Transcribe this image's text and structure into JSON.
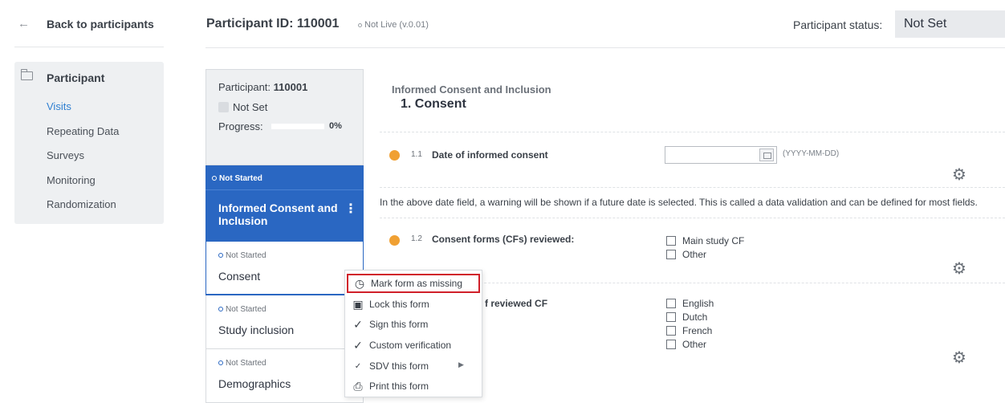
{
  "nav": {
    "back_label": "Back to participants",
    "back_icon": "arrow-left-icon",
    "section_title": "Participant",
    "section_icon": "folder-icon",
    "items": [
      {
        "label": "Visits",
        "active": true
      },
      {
        "label": "Repeating Data",
        "active": false
      },
      {
        "label": "Surveys",
        "active": false
      },
      {
        "label": "Monitoring",
        "active": false
      },
      {
        "label": "Randomization",
        "active": false
      }
    ]
  },
  "header": {
    "participant_id_title": "Participant ID: 110001",
    "live_status": "Not Live (v.0.01)",
    "status_label": "Participant status:",
    "status_value": "Not Set"
  },
  "summary": {
    "participant_label": "Participant: ",
    "participant_id": "110001",
    "status": "Not Set",
    "progress_label": "Progress:",
    "progress_percent": "0%",
    "progress_fraction": 0
  },
  "forms": [
    {
      "status": "Not Started",
      "name": "Informed Consent and Inclusion",
      "selected": true
    },
    {
      "status": "Not Started",
      "name": "Consent"
    },
    {
      "status": "Not Started",
      "name": "Study inclusion"
    },
    {
      "status": "Not Started",
      "name": "Demographics"
    }
  ],
  "main": {
    "section_title": "Informed Consent and Inclusion",
    "form_title": "1. Consent",
    "info_text": "In the above date field, a warning will be shown if a future date is selected. This is called a data validation and can be defined for most fields.",
    "questions": [
      {
        "number": "1.1",
        "label": "Date of informed consent",
        "date_hint": "(YYYY-MM-DD)"
      },
      {
        "number": "1.2",
        "label": "Consent forms (CFs) reviewed:",
        "options": [
          "Main study CF",
          "Other"
        ]
      },
      {
        "label_visible": "f reviewed CF",
        "options": [
          "English",
          "Dutch",
          "French",
          "Other"
        ]
      }
    ]
  },
  "context_menu": {
    "items": [
      {
        "label": "Mark form as missing",
        "icon": "clock-question-icon",
        "highlighted": true
      },
      {
        "label": "Lock this form",
        "icon": "lock-icon"
      },
      {
        "label": "Sign this form",
        "icon": "check-circle-icon"
      },
      {
        "label": "Custom verification",
        "icon": "check-circle-icon"
      },
      {
        "label": "SDV this form",
        "icon": "sdv-icon",
        "has_submenu": true
      },
      {
        "label": "Print this form",
        "icon": "printer-icon"
      }
    ]
  },
  "colors": {
    "accent_blue": "#2a67c2",
    "link_blue": "#2f7fd1",
    "required_orange": "#f0a033",
    "highlight_red": "#d0202a"
  }
}
